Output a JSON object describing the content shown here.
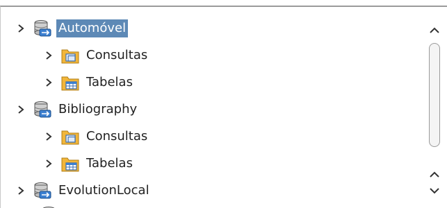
{
  "tree": {
    "databases": [
      {
        "label": "Automóvel",
        "selected": true,
        "children": [
          {
            "label": "Consultas",
            "icon": "queries-folder-icon"
          },
          {
            "label": "Tabelas",
            "icon": "tables-folder-icon"
          }
        ]
      },
      {
        "label": "Bibliography",
        "selected": false,
        "children": [
          {
            "label": "Consultas",
            "icon": "queries-folder-icon"
          },
          {
            "label": "Tabelas",
            "icon": "tables-folder-icon"
          }
        ]
      },
      {
        "label": "EvolutionLocal",
        "selected": false,
        "children": []
      }
    ]
  },
  "colors": {
    "selection": "#5d89b6",
    "folder": "#f2b63a",
    "database": "#3b7fd0"
  },
  "scrollbar": {
    "up_icon": "chevron-up-icon",
    "down_icon": "chevron-down-icon"
  }
}
